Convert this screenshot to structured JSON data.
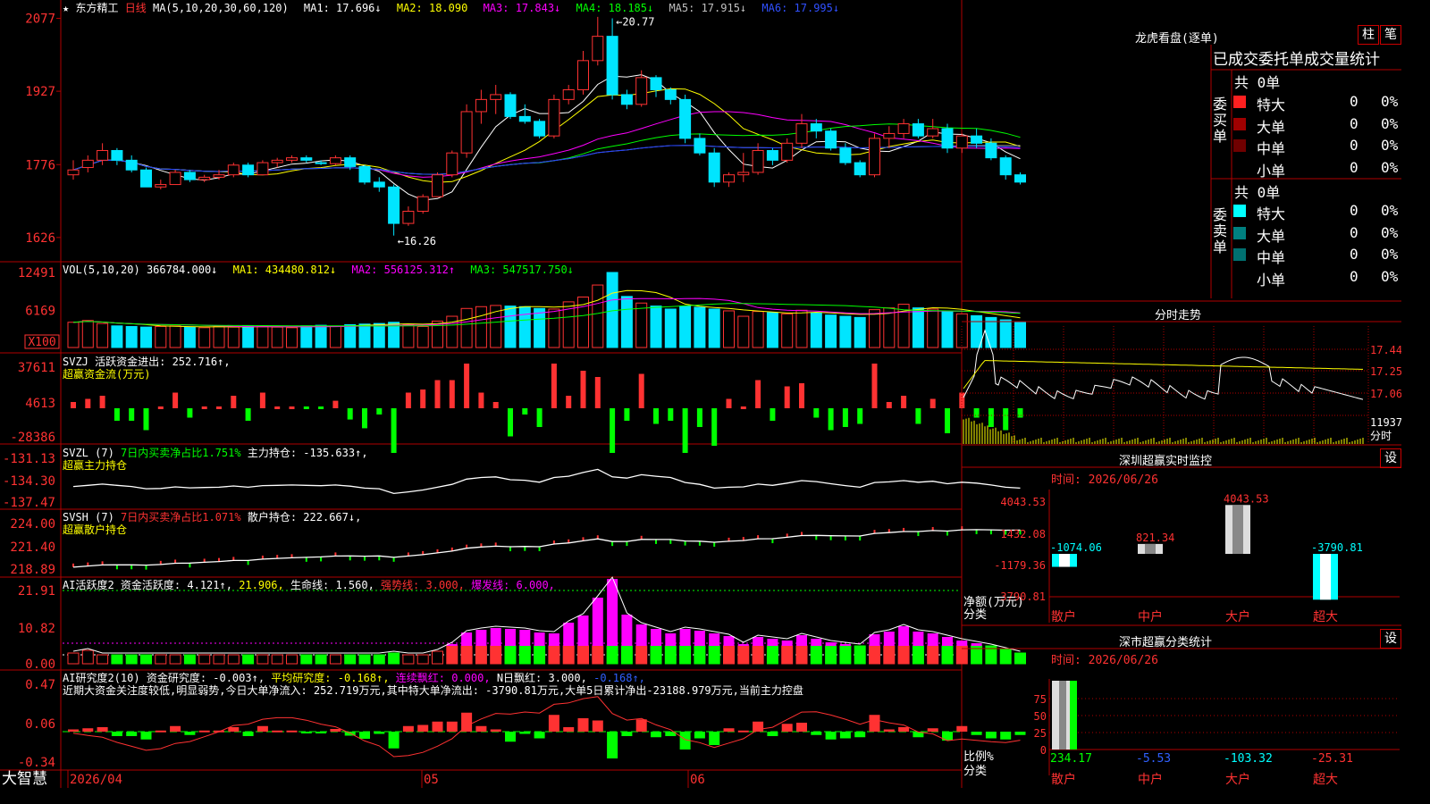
{
  "colors": {
    "up": "#ff3232",
    "down": "#00e5ff",
    "ma1": "#ffffff",
    "ma2": "#ffff00",
    "ma3": "#ff00ff",
    "ma4": "#00ff00",
    "ma5": "#a0a0a0",
    "ma6": "#2040ff",
    "grid": "#b00000",
    "green": "#00ff00",
    "yellow": "#ffff00",
    "magenta": "#ff00ff",
    "cyan": "#00ffff",
    "blue": "#3060ff"
  },
  "header": {
    "star": "★",
    "stock": "东方精工",
    "period": "日线",
    "ma_params": "MA(5,10,20,30,60,120)",
    "ma1": "MA1: 17.696↓",
    "ma2": "MA2: 18.090",
    "ma3": "MA3: 17.843↓",
    "ma4": "MA4: 18.185↓",
    "ma5": "MA5: 17.915↓",
    "ma6": "MA6: 17.995↓"
  },
  "price_axis": [
    "2077",
    "1927",
    "1776",
    "1626"
  ],
  "price_annotations": {
    "high": "20.77",
    "low": "16.26"
  },
  "vol": {
    "label": "VOL(5,10,20)",
    "value": "366784.000↓",
    "ma1": "MA1: 434480.812↓",
    "ma2": "MA2: 556125.312↑",
    "ma3": "MA3: 547517.750↓",
    "axis": [
      "12491",
      "6169"
    ],
    "unit": "X100"
  },
  "svzj": {
    "label": "SVZJ  活跃资金进出: 252.716↑,",
    "sub": "超赢资金流(万元)",
    "axis": [
      "37611",
      "4613",
      "-28386"
    ]
  },
  "svzl": {
    "label": "SVZL (7)",
    "pct": "7日内买卖净占比1.751%",
    "hold": "主力持仓: -135.633↑,",
    "sub": "超赢主力持仓",
    "axis": [
      "-131.13",
      "-134.30",
      "-137.47"
    ]
  },
  "svsh": {
    "label": "SVSH (7)",
    "pct": "7日内买卖净占比1.071%",
    "hold": "散户持仓: 222.667↓,",
    "sub": "超赢散户持仓",
    "axis": [
      "224.00",
      "221.40",
      "218.89"
    ]
  },
  "ai_active": {
    "label": "AI活跃度2",
    "v1": "资金活跃度: 4.121↑,",
    "v2": "21.906,",
    "v3": "生命线: 1.560,",
    "v4": "强势线: 3.000,",
    "v5": "爆发线: 6.000,",
    "axis": [
      "21.91",
      "10.82",
      "0.00"
    ]
  },
  "ai_research": {
    "label": "AI研究度2(10)",
    "v1": "资金研究度: -0.003↑,",
    "v2": "平均研究度: -0.168↑,",
    "v3": "连续飘红: 0.000,",
    "v4": "N日飘红: 3.000,",
    "v5": "-0.168↑,",
    "text": "近期大资金关注度较低,明显弱势,今日大单净流入: 252.719万元,其中特大单净流出: -3790.81万元,大单5日累计净出-23188.979万元,当前主力控盘",
    "axis": [
      "0.47",
      "0.06",
      "-0.34"
    ]
  },
  "dates": [
    "2026/04",
    "05",
    "06"
  ],
  "brand": "大智慧",
  "dragon": {
    "title": "龙虎看盘(逐单)",
    "btn1": "柱",
    "btn2": "笔",
    "heading": "已成交委托单成交量统计",
    "buy_label": "委买单",
    "sell_label": "委卖单",
    "buy_total": "共 0单",
    "sell_total": "共 0单",
    "buy_rows": [
      {
        "name": "特大",
        "val": "0",
        "pct": "0%",
        "color": "#ff2020"
      },
      {
        "name": "大单",
        "val": "0",
        "pct": "0%",
        "color": "#a00000"
      },
      {
        "name": "中单",
        "val": "0",
        "pct": "0%",
        "color": "#700000"
      },
      {
        "name": "小单",
        "val": "0",
        "pct": "0%",
        "color": ""
      }
    ],
    "sell_rows": [
      {
        "name": "特大",
        "val": "0",
        "pct": "0%",
        "color": "#00ffff"
      },
      {
        "name": "大单",
        "val": "0",
        "pct": "0%",
        "color": "#008080"
      },
      {
        "name": "中单",
        "val": "0",
        "pct": "0%",
        "color": "#007070"
      },
      {
        "name": "小单",
        "val": "0",
        "pct": "0%",
        "color": ""
      }
    ]
  },
  "intraday": {
    "title": "分时走势",
    "axis": [
      "17.44",
      "17.25",
      "17.06"
    ],
    "vol_label": "11937",
    "vol_sub": "分时"
  },
  "sz_monitor": {
    "title": "深圳超赢实时监控",
    "btn": "设",
    "time": "时间: 2026/06/26",
    "axis": [
      "4043.53",
      "1432.08",
      "-1179.36",
      "-3790.81"
    ],
    "unit": "净额(万元)",
    "cat_label": "分类",
    "chart_data": {
      "type": "bar",
      "categories": [
        "散户",
        "中户",
        "大户",
        "超大"
      ],
      "values": [
        -1074.06,
        821.34,
        4043.53,
        -3790.81
      ],
      "ylim": [
        -3790.81,
        4043.53
      ],
      "labels": [
        "-1074.06",
        "821.34",
        "4043.53",
        "-3790.81"
      ]
    }
  },
  "sz_class": {
    "title": "深市超赢分类统计",
    "btn": "设",
    "time": "时间: 2026/06/26",
    "axis": [
      "75",
      "50",
      "25",
      "0"
    ],
    "unit": "比例%",
    "cat_label": "分类",
    "chart_data": {
      "type": "bar",
      "categories": [
        "散户",
        "中户",
        "大户",
        "超大"
      ],
      "values": [
        234.17,
        -5.53,
        -103.32,
        -25.31
      ],
      "ylim": [
        0,
        75
      ],
      "labels": [
        "234.17",
        "-5.53",
        "-103.32",
        "-25.31"
      ]
    }
  },
  "chart_data": {
    "type": "candlestick",
    "title": "东方精工 日线",
    "ylim": [
      16.0,
      21.0
    ],
    "candles": [
      [
        17.55,
        17.85,
        17.45,
        17.65
      ],
      [
        17.7,
        17.95,
        17.6,
        17.85
      ],
      [
        17.85,
        18.2,
        17.75,
        18.05
      ],
      [
        18.05,
        18.1,
        17.75,
        17.85
      ],
      [
        17.85,
        17.95,
        17.6,
        17.65
      ],
      [
        17.65,
        17.7,
        17.3,
        17.3
      ],
      [
        17.3,
        17.45,
        17.25,
        17.35
      ],
      [
        17.35,
        17.65,
        17.35,
        17.6
      ],
      [
        17.6,
        17.65,
        17.4,
        17.45
      ],
      [
        17.45,
        17.55,
        17.4,
        17.5
      ],
      [
        17.5,
        17.65,
        17.45,
        17.55
      ],
      [
        17.55,
        17.8,
        17.5,
        17.75
      ],
      [
        17.75,
        17.8,
        17.5,
        17.55
      ],
      [
        17.55,
        17.85,
        17.55,
        17.8
      ],
      [
        17.8,
        17.9,
        17.7,
        17.85
      ],
      [
        17.85,
        17.95,
        17.8,
        17.9
      ],
      [
        17.9,
        17.95,
        17.8,
        17.85
      ],
      [
        17.8,
        17.85,
        17.75,
        17.78
      ],
      [
        17.78,
        17.95,
        17.75,
        17.9
      ],
      [
        17.9,
        17.95,
        17.65,
        17.72
      ],
      [
        17.72,
        17.75,
        17.35,
        17.4
      ],
      [
        17.4,
        17.5,
        17.2,
        17.3
      ],
      [
        17.3,
        17.35,
        16.3,
        16.55
      ],
      [
        16.55,
        16.9,
        16.5,
        16.8
      ],
      [
        16.8,
        17.15,
        16.75,
        17.1
      ],
      [
        17.1,
        17.6,
        17.1,
        17.55
      ],
      [
        17.55,
        18.05,
        17.5,
        18.0
      ],
      [
        18.0,
        19.0,
        17.9,
        18.85
      ],
      [
        18.85,
        19.3,
        18.6,
        19.1
      ],
      [
        19.1,
        19.4,
        18.8,
        19.2
      ],
      [
        19.2,
        19.25,
        18.7,
        18.75
      ],
      [
        18.75,
        19.0,
        18.6,
        18.65
      ],
      [
        18.65,
        18.7,
        18.3,
        18.35
      ],
      [
        18.35,
        19.2,
        18.3,
        19.1
      ],
      [
        19.1,
        19.4,
        19.0,
        19.3
      ],
      [
        19.3,
        20.1,
        19.2,
        19.9
      ],
      [
        19.9,
        20.8,
        19.8,
        20.4
      ],
      [
        20.4,
        20.77,
        19.1,
        19.2
      ],
      [
        19.2,
        19.3,
        18.9,
        19.0
      ],
      [
        19.0,
        19.7,
        18.95,
        19.55
      ],
      [
        19.55,
        19.6,
        19.15,
        19.3
      ],
      [
        19.3,
        19.35,
        19.0,
        19.1
      ],
      [
        19.1,
        19.2,
        18.2,
        18.3
      ],
      [
        18.3,
        18.4,
        17.95,
        18.0
      ],
      [
        18.0,
        18.1,
        17.3,
        17.4
      ],
      [
        17.4,
        17.6,
        17.3,
        17.55
      ],
      [
        17.55,
        18.0,
        17.4,
        17.6
      ],
      [
        17.6,
        18.2,
        17.55,
        18.05
      ],
      [
        18.05,
        18.1,
        17.75,
        17.85
      ],
      [
        17.85,
        18.3,
        17.8,
        18.2
      ],
      [
        18.2,
        18.8,
        18.1,
        18.6
      ],
      [
        18.6,
        18.7,
        18.3,
        18.45
      ],
      [
        18.45,
        18.5,
        18.05,
        18.1
      ],
      [
        18.1,
        18.2,
        17.75,
        17.8
      ],
      [
        17.8,
        17.85,
        17.5,
        17.55
      ],
      [
        17.55,
        18.4,
        17.5,
        18.3
      ],
      [
        18.3,
        18.55,
        18.1,
        18.4
      ],
      [
        18.4,
        18.7,
        18.3,
        18.6
      ],
      [
        18.6,
        18.7,
        18.3,
        18.35
      ],
      [
        18.35,
        18.7,
        18.3,
        18.5
      ],
      [
        18.5,
        18.6,
        18.0,
        18.1
      ],
      [
        18.1,
        18.4,
        18.0,
        18.35
      ],
      [
        18.35,
        18.5,
        18.1,
        18.2
      ],
      [
        18.2,
        18.3,
        17.85,
        17.9
      ],
      [
        17.9,
        17.95,
        17.45,
        17.55
      ],
      [
        17.55,
        17.6,
        17.35,
        17.4
      ]
    ],
    "volume": [
      4.2,
      4.5,
      4.0,
      3.6,
      3.5,
      3.4,
      3.5,
      3.6,
      3.4,
      3.3,
      3.5,
      3.4,
      3.6,
      3.5,
      3.4,
      3.3,
      3.6,
      3.7,
      3.5,
      3.8,
      3.9,
      4.0,
      4.2,
      3.8,
      3.5,
      4.4,
      5.2,
      6.5,
      6.8,
      7.0,
      6.9,
      6.8,
      6.5,
      6.4,
      7.6,
      8.4,
      10.4,
      12.49,
      8.5,
      7.4,
      6.9,
      6.4,
      6.9,
      6.7,
      6.4,
      6.1,
      5.2,
      6.0,
      5.8,
      5.6,
      6.2,
      5.8,
      5.4,
      5.2,
      5.0,
      6.3,
      6.6,
      7.2,
      6.6,
      6.4,
      6.0,
      5.6,
      5.3,
      5.0,
      4.6,
      4.2
    ]
  }
}
